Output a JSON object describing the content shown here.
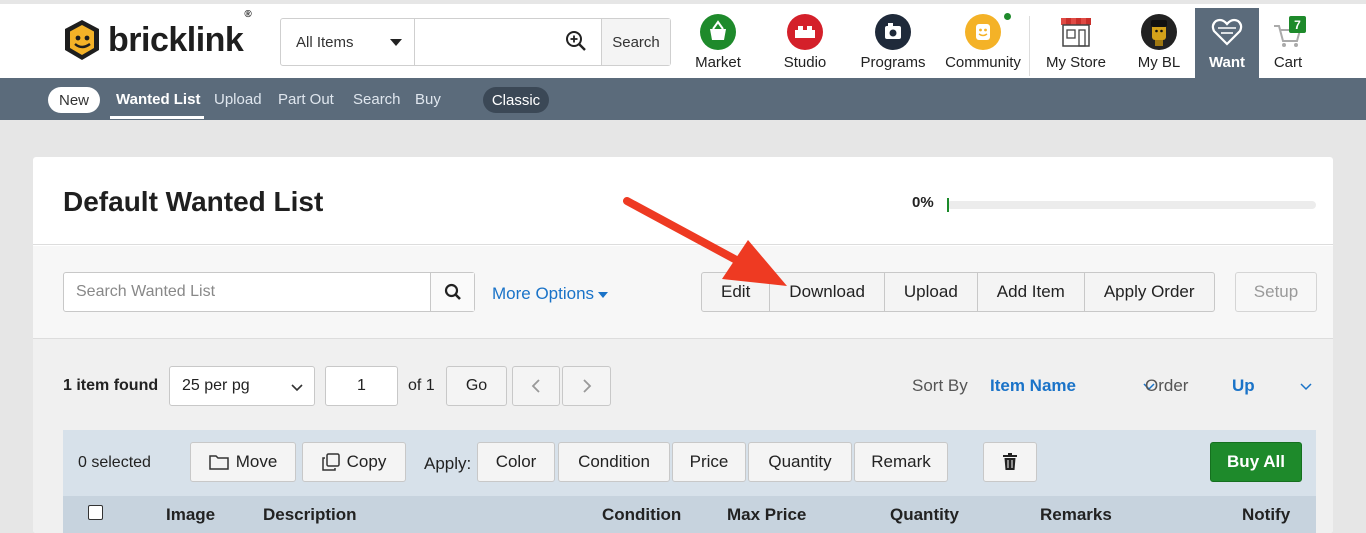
{
  "header": {
    "logo_text": "bricklink",
    "logo_reg": "®",
    "search": {
      "scope": "All Items",
      "button": "Search",
      "value": ""
    },
    "nav": [
      {
        "label": "Market",
        "icon": "basket-icon",
        "color": "#1e8a2b"
      },
      {
        "label": "Studio",
        "icon": "brick-icon",
        "color": "#d4202a"
      },
      {
        "label": "Programs",
        "icon": "camera-icon",
        "color": "#1f2a3a"
      },
      {
        "label": "Community",
        "icon": "minifig-face-icon",
        "color": "#f4b227"
      },
      {
        "label": "My Store",
        "icon": "storefront-icon",
        "color": "#c9302c"
      },
      {
        "label": "My BL",
        "icon": "avatar",
        "color": "#222222"
      },
      {
        "label": "Want",
        "icon": "heart-icon",
        "color": "#5b6b7b"
      },
      {
        "label": "Cart",
        "icon": "cart-icon",
        "badge": "7",
        "color": "#1e8a2b"
      }
    ]
  },
  "subnav": {
    "new_pill": "New",
    "links": [
      "Wanted List",
      "Upload",
      "Part Out",
      "Search",
      "Buy"
    ],
    "active": "Wanted List",
    "classic_pill": "Classic"
  },
  "list": {
    "title": "Default Wanted List",
    "progress_label": "0%",
    "progress_fraction": 0
  },
  "toolbar": {
    "search_placeholder": "Search Wanted List",
    "more_options": "More Options",
    "buttons": [
      "Edit",
      "Download",
      "Upload",
      "Add Item",
      "Apply Order"
    ],
    "setup": "Setup"
  },
  "results": {
    "count_text": "1 item found",
    "per_page": "25 per pg",
    "page": "1",
    "of_text": "of 1",
    "go": "Go",
    "sort_by_label": "Sort By",
    "sort_by_value": "Item Name",
    "order_label": "Order",
    "order_value": "Up"
  },
  "selection": {
    "selected_text": "0 selected",
    "move": "Move",
    "copy": "Copy",
    "apply_label": "Apply:",
    "apply_buttons": [
      "Color",
      "Condition",
      "Price",
      "Quantity",
      "Remark"
    ],
    "buy_all": "Buy All"
  },
  "table": {
    "columns": [
      "Image",
      "Description",
      "Condition",
      "Max Price",
      "Quantity",
      "Remarks",
      "Notify"
    ]
  },
  "annotation": {
    "arrow_color": "#ee3a22"
  }
}
